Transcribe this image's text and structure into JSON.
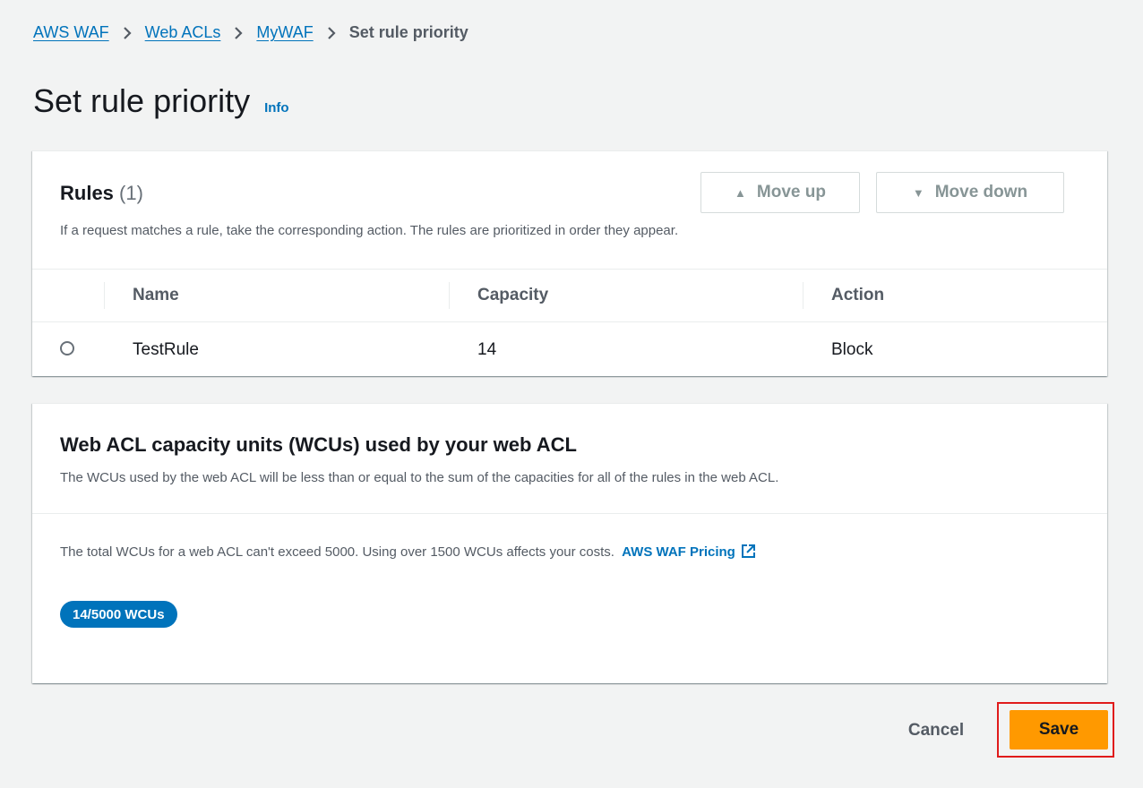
{
  "breadcrumb": {
    "items": [
      "AWS WAF",
      "Web ACLs",
      "MyWAF"
    ],
    "current": "Set rule priority"
  },
  "page": {
    "title": "Set rule priority",
    "info_label": "Info"
  },
  "rules": {
    "title": "Rules",
    "count": "(1)",
    "description": "If a request matches a rule, take the corresponding action. The rules are prioritized in order they appear.",
    "move_up_label": "Move up",
    "move_down_label": "Move down",
    "columns": [
      "Name",
      "Capacity",
      "Action"
    ],
    "rows": [
      {
        "name": "TestRule",
        "capacity": "14",
        "action": "Block"
      }
    ]
  },
  "wcu": {
    "title": "Web ACL capacity units (WCUs) used by your web ACL",
    "description": "The WCUs used by the web ACL will be less than or equal to the sum of the capacities for all of the rules in the web ACL.",
    "body_text": "The total WCUs for a web ACL can't exceed 5000. Using over 1500 WCUs affects your costs.",
    "pricing_link": "AWS WAF Pricing",
    "badge": "14/5000 WCUs"
  },
  "footer": {
    "cancel_label": "Cancel",
    "save_label": "Save"
  },
  "colors": {
    "link": "#0073bb",
    "primary_button": "#ff9900",
    "highlight_outline": "#e01b1b",
    "badge": "#0073bb"
  }
}
